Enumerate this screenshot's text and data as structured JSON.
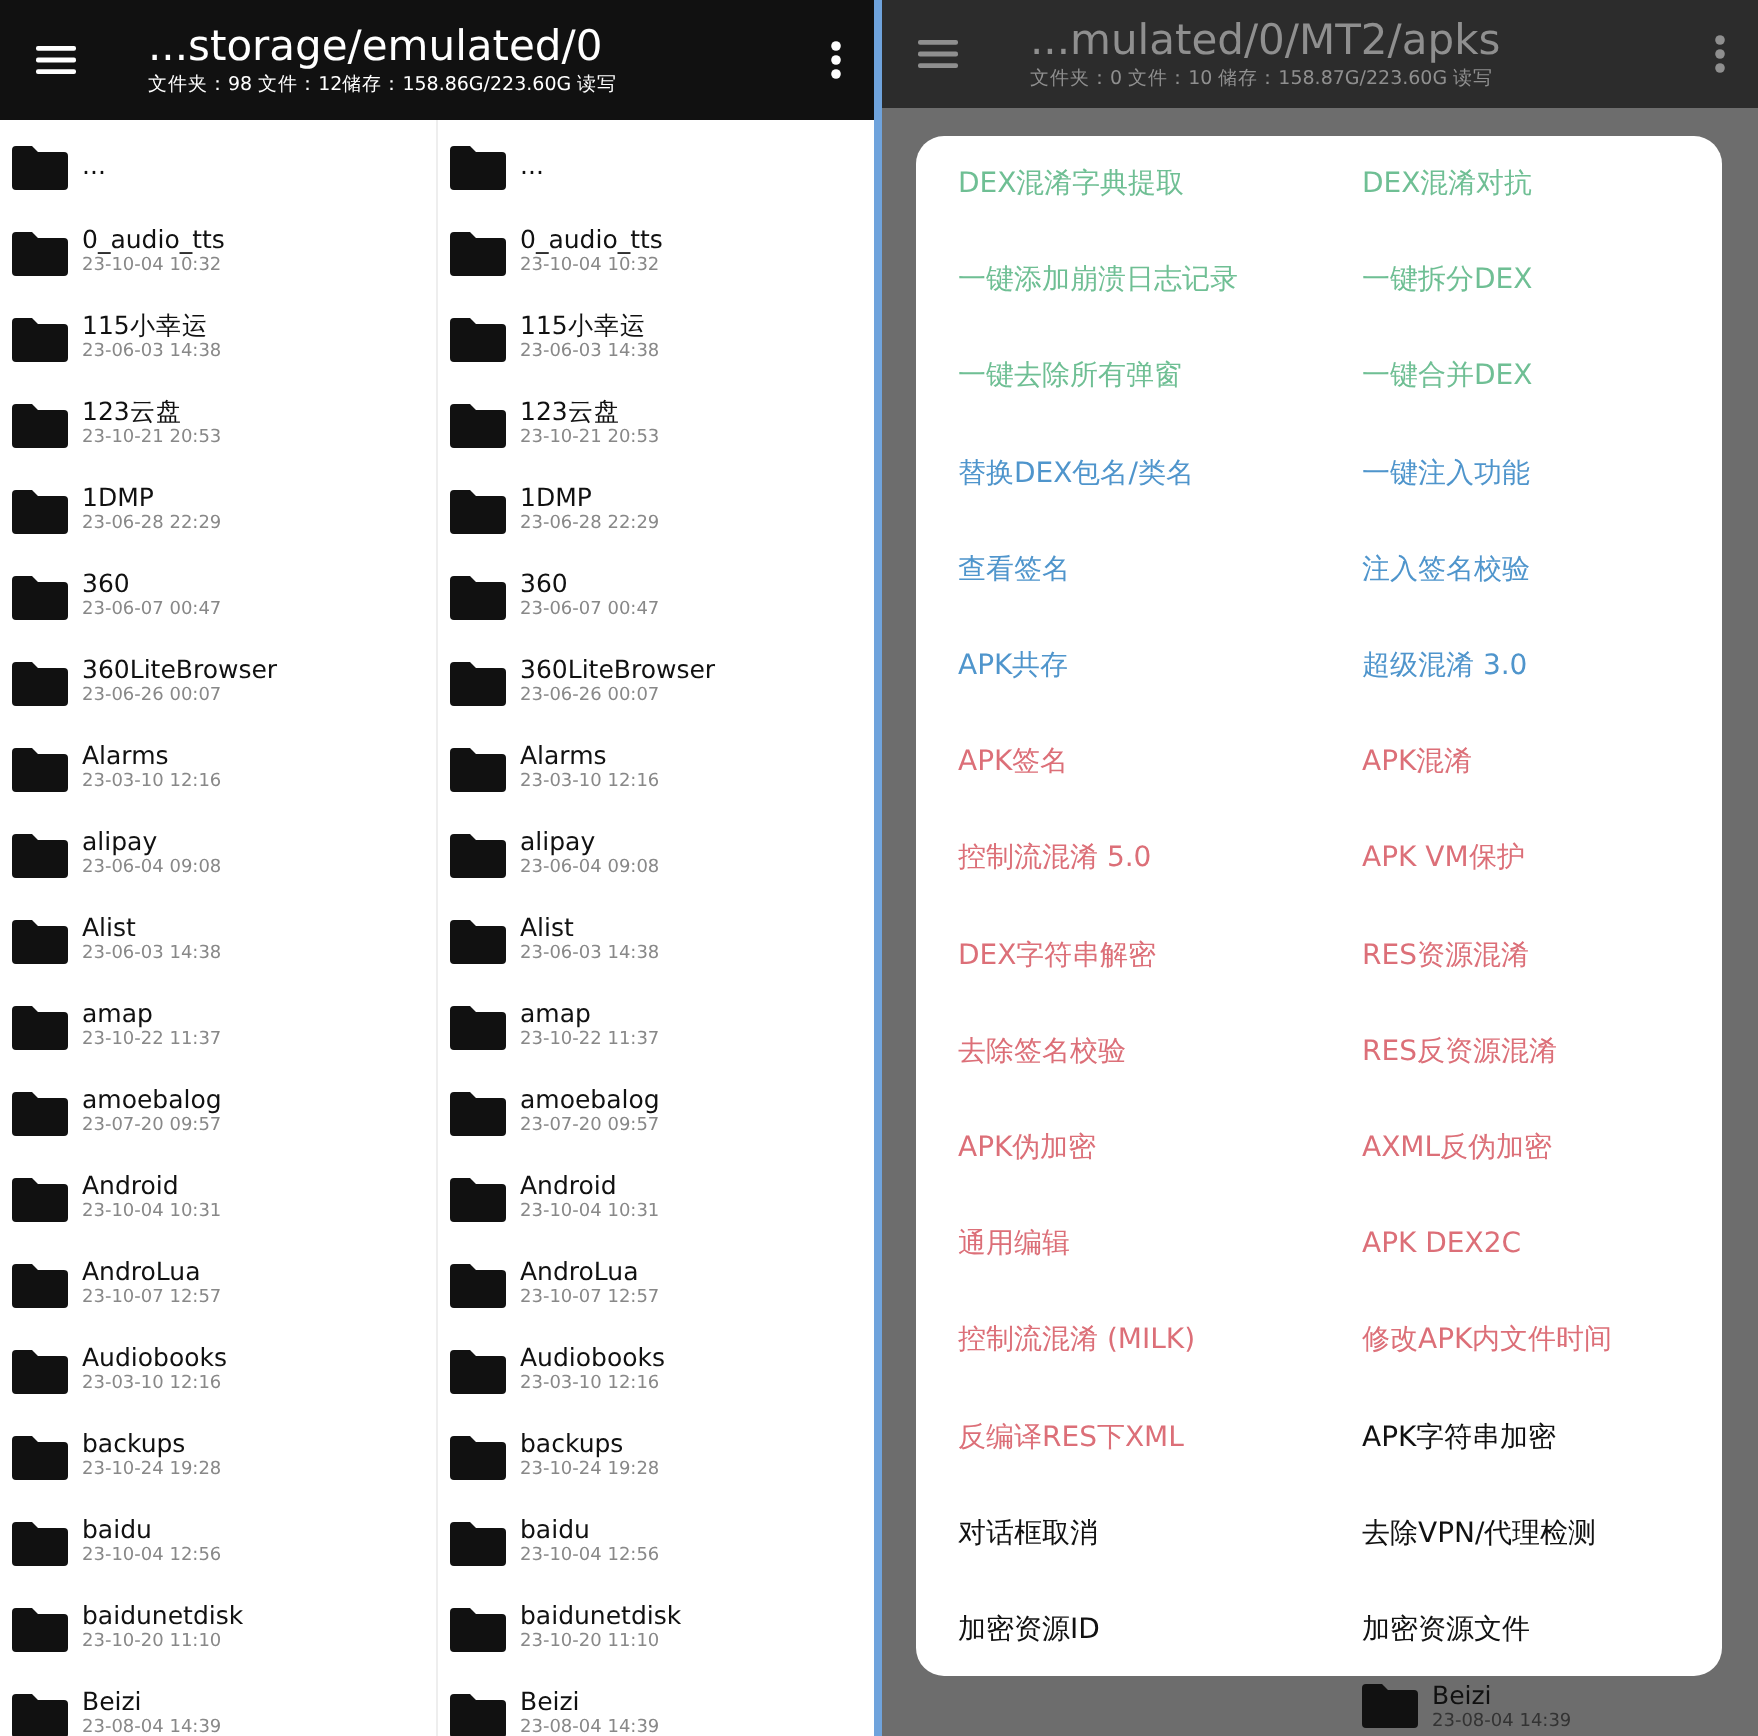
{
  "left_screen": {
    "path": "...storage/emulated/0",
    "info": "文件夹：98  文件：12储存：158.86G/223.60G  读写",
    "panes": [
      {
        "items": [
          {
            "name": "..."
          },
          {
            "name": "0_audio_tts",
            "date": "23-10-04 10:32"
          },
          {
            "name": "115小幸运",
            "date": "23-06-03 14:38"
          },
          {
            "name": "123云盘",
            "date": "23-10-21 20:53"
          },
          {
            "name": "1DMP",
            "date": "23-06-28 22:29"
          },
          {
            "name": "360",
            "date": "23-06-07 00:47"
          },
          {
            "name": "360LiteBrowser",
            "date": "23-06-26 00:07"
          },
          {
            "name": "Alarms",
            "date": "23-03-10 12:16"
          },
          {
            "name": "alipay",
            "date": "23-06-04 09:08"
          },
          {
            "name": "Alist",
            "date": "23-06-03 14:38"
          },
          {
            "name": "amap",
            "date": "23-10-22 11:37"
          },
          {
            "name": "amoebalog",
            "date": "23-07-20 09:57"
          },
          {
            "name": "Android",
            "date": "23-10-04 10:31"
          },
          {
            "name": "AndroLua",
            "date": "23-10-07 12:57"
          },
          {
            "name": "Audiobooks",
            "date": "23-03-10 12:16"
          },
          {
            "name": "backups",
            "date": "23-10-24 19:28"
          },
          {
            "name": "baidu",
            "date": "23-10-04 12:56"
          },
          {
            "name": "baidunetdisk",
            "date": "23-10-20 11:10"
          },
          {
            "name": "Beizi",
            "date": "23-08-04 14:39"
          }
        ]
      },
      {
        "items": [
          {
            "name": "..."
          },
          {
            "name": "0_audio_tts",
            "date": "23-10-04 10:32"
          },
          {
            "name": "115小幸运",
            "date": "23-06-03 14:38"
          },
          {
            "name": "123云盘",
            "date": "23-10-21 20:53"
          },
          {
            "name": "1DMP",
            "date": "23-06-28 22:29"
          },
          {
            "name": "360",
            "date": "23-06-07 00:47"
          },
          {
            "name": "360LiteBrowser",
            "date": "23-06-26 00:07"
          },
          {
            "name": "Alarms",
            "date": "23-03-10 12:16"
          },
          {
            "name": "alipay",
            "date": "23-06-04 09:08"
          },
          {
            "name": "Alist",
            "date": "23-06-03 14:38"
          },
          {
            "name": "amap",
            "date": "23-10-22 11:37"
          },
          {
            "name": "amoebalog",
            "date": "23-07-20 09:57"
          },
          {
            "name": "Android",
            "date": "23-10-04 10:31"
          },
          {
            "name": "AndroLua",
            "date": "23-10-07 12:57"
          },
          {
            "name": "Audiobooks",
            "date": "23-03-10 12:16"
          },
          {
            "name": "backups",
            "date": "23-10-24 19:28"
          },
          {
            "name": "baidu",
            "date": "23-10-04 12:56"
          },
          {
            "name": "baidunetdisk",
            "date": "23-10-20 11:10"
          },
          {
            "name": "Beizi",
            "date": "23-08-04 14:39"
          }
        ]
      }
    ]
  },
  "right_screen": {
    "path": "...mulated/0/MT2/apks",
    "info": "文件夹：0  文件：10  储存：158.87G/223.60G  读写",
    "background_item": {
      "name": "Beizi",
      "date": "23-08-04 14:39"
    },
    "dialog": {
      "options": [
        {
          "label": "DEX混淆字典提取",
          "color": "#6fbf94"
        },
        {
          "label": "DEX混淆对抗",
          "color": "#6fbf94"
        },
        {
          "label": "一键添加崩溃日志记录",
          "color": "#6fbf94"
        },
        {
          "label": "一键拆分DEX",
          "color": "#6fbf94"
        },
        {
          "label": "一键去除所有弹窗",
          "color": "#6fbf94"
        },
        {
          "label": "一键合并DEX",
          "color": "#6fbf94"
        },
        {
          "label": "替换DEX包名/类名",
          "color": "#4f95cc"
        },
        {
          "label": "一键注入功能",
          "color": "#4f95cc"
        },
        {
          "label": "查看签名",
          "color": "#4f95cc"
        },
        {
          "label": "注入签名校验",
          "color": "#4f95cc"
        },
        {
          "label": "APK共存",
          "color": "#4f95cc"
        },
        {
          "label": "超级混淆 3.0",
          "color": "#4f95cc"
        },
        {
          "label": "APK签名",
          "color": "#dc6f78"
        },
        {
          "label": "APK混淆",
          "color": "#dc6f78"
        },
        {
          "label": "控制流混淆 5.0",
          "color": "#dc6f78"
        },
        {
          "label": "APK VM保护",
          "color": "#dc6f78"
        },
        {
          "label": "DEX字符串解密",
          "color": "#dc6f78"
        },
        {
          "label": "RES资源混淆",
          "color": "#dc6f78"
        },
        {
          "label": "去除签名校验",
          "color": "#dc6f78"
        },
        {
          "label": "RES反资源混淆",
          "color": "#dc6f78"
        },
        {
          "label": "APK伪加密",
          "color": "#dc6f78"
        },
        {
          "label": "AXML反伪加密",
          "color": "#dc6f78"
        },
        {
          "label": "通用编辑",
          "color": "#dc6f78"
        },
        {
          "label": "APK DEX2C",
          "color": "#dc6f78"
        },
        {
          "label": "控制流混淆 (MILK)",
          "color": "#dc6f78"
        },
        {
          "label": "修改APK内文件时间",
          "color": "#dc6f78"
        },
        {
          "label": "反编译RES下XML",
          "color": "#dc6f78"
        },
        {
          "label": "APK字符串加密",
          "color": "#111111"
        },
        {
          "label": "对话框取消",
          "color": "#111111"
        },
        {
          "label": "去除VPN/代理检测",
          "color": "#111111"
        },
        {
          "label": "加密资源ID",
          "color": "#111111"
        },
        {
          "label": "加密资源文件",
          "color": "#111111"
        }
      ]
    }
  }
}
